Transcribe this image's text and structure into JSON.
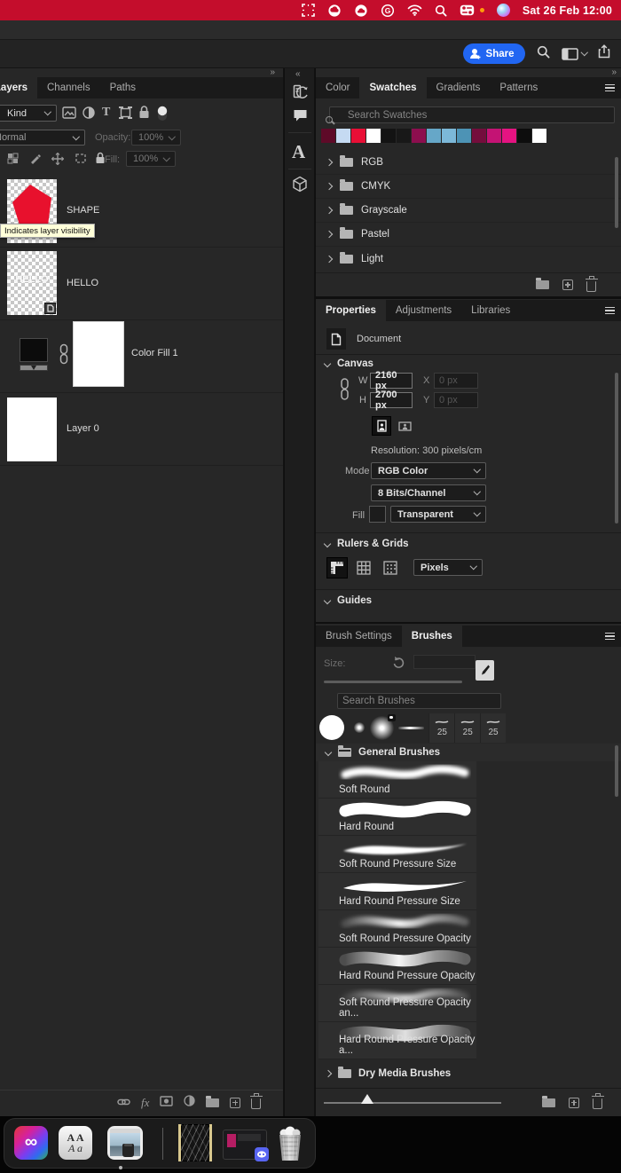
{
  "menubar": {
    "bg_color": "#c40d2c",
    "clock": "Sat 26 Feb 12:00",
    "status_icons": [
      "screenshot-selection",
      "creative-cloud",
      "cloud-app",
      "g-app",
      "wifi",
      "search",
      "control-center",
      "notification-dot",
      "siri"
    ]
  },
  "toolbar": {
    "share_label": "Share"
  },
  "panel_chrome": {
    "collapse_left": "»",
    "collapse_strip": "«",
    "collapse_right": "»"
  },
  "layers_panel": {
    "tabs": [
      {
        "label": "Layers"
      },
      {
        "label": "Channels"
      },
      {
        "label": "Paths"
      }
    ],
    "kind_label": "Kind",
    "blend_mode_value": "Normal",
    "opacity_label": "Opacity:",
    "opacity_value": "100%",
    "fill_label": "Fill:",
    "fill_value": "100%",
    "fx_label": "fx",
    "tooltip_text": "Indicates layer visibility",
    "hello_thumb_text": "HELLO",
    "layers": [
      {
        "name": "SHAPE"
      },
      {
        "name": "HELLO"
      },
      {
        "name": "Color Fill 1"
      },
      {
        "name": "Layer 0"
      }
    ]
  },
  "tool_strip": {
    "character_glyph": "A"
  },
  "swatches_panel": {
    "tabs": [
      {
        "label": "Color"
      },
      {
        "label": "Swatches"
      },
      {
        "label": "Gradients"
      },
      {
        "label": "Patterns"
      }
    ],
    "search_placeholder": "Search Swatches",
    "colors": [
      "#5e0a28",
      "#c5daf2",
      "#e90f36",
      "#ffffff",
      "#131313",
      "#181818",
      "#8c0e4e",
      "#66a7c8",
      "#7cb8d8",
      "#4d93b5",
      "#740d3c",
      "#c41374",
      "#e51381",
      "#0d0d0d",
      "#ffffff"
    ],
    "groups": [
      {
        "label": "RGB"
      },
      {
        "label": "CMYK"
      },
      {
        "label": "Grayscale"
      },
      {
        "label": "Pastel"
      },
      {
        "label": "Light"
      }
    ]
  },
  "properties_panel": {
    "tabs": [
      {
        "label": "Properties"
      },
      {
        "label": "Adjustments"
      },
      {
        "label": "Libraries"
      }
    ],
    "document_label": "Document",
    "canvas_section": "Canvas",
    "w_label": "W",
    "w_value": "2160 px",
    "x_label": "X",
    "x_value": "0 px",
    "h_label": "H",
    "h_value": "2700 px",
    "y_label": "Y",
    "y_value": "0 px",
    "resolution_text": "Resolution: 300 pixels/cm",
    "mode_label": "Mode",
    "mode_value": "RGB Color",
    "bits_value": "8 Bits/Channel",
    "fill_label": "Fill",
    "fill_value": "Transparent",
    "rulers_section": "Rulers & Grids",
    "units_value": "Pixels",
    "guides_section": "Guides"
  },
  "brushes_panel": {
    "tabs": [
      {
        "label": "Brush Settings"
      },
      {
        "label": "Brushes"
      }
    ],
    "size_label": "Size:",
    "search_placeholder": "Search Brushes",
    "recent_counts": [
      "25",
      "25",
      "25"
    ],
    "group_general": "General Brushes",
    "group_dry": "Dry Media Brushes",
    "items": [
      "Soft Round",
      "Hard Round",
      "Soft Round Pressure Size",
      "Hard Round Pressure Size",
      "Soft Round Pressure Opacity",
      "Hard Round Pressure Opacity",
      "Soft Round Pressure Opacity an...",
      "Hard Round Pressure Opacity a..."
    ]
  },
  "dock": {
    "font_book_top": "A A",
    "font_book_bottom": "A a",
    "icons": [
      "creative-cloud",
      "font-book",
      "preview-photo",
      "minimized-artwork",
      "minimized-window-discord",
      "trash-full"
    ]
  }
}
